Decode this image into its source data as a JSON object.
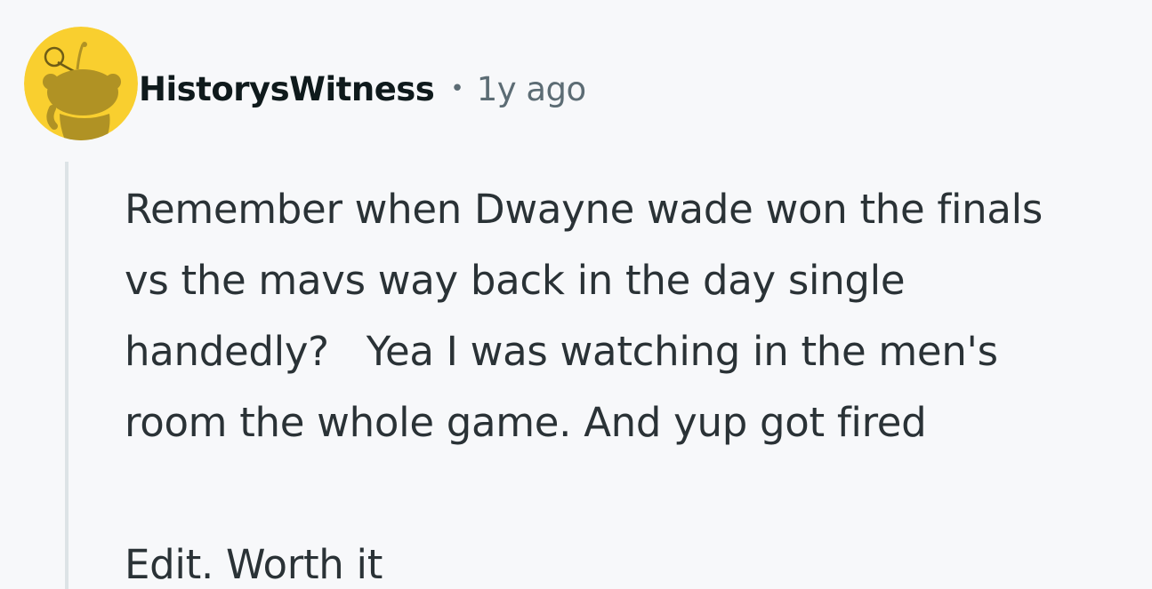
{
  "comment": {
    "author": "HistorysWitness",
    "separator": "•",
    "timestamp": "1y ago",
    "avatar_icon": "reddit-snoo-avatar-icon",
    "body_lines": [
      "Remember when Dwayne wade won the finals",
      "vs the mavs way back in the day single",
      "handedly?   Yea I was watching in the men's",
      "room the whole game. And yup got fired"
    ],
    "edit_line": "Edit. Worth it"
  },
  "colors": {
    "background": "#f7f8fa",
    "avatar_bg": "#f9cf2f",
    "avatar_figure": "#b09224",
    "thread_line": "#dde3e6",
    "author": "#0f1a1c",
    "meta": "#5c6c74",
    "body_text": "#2a3236"
  }
}
